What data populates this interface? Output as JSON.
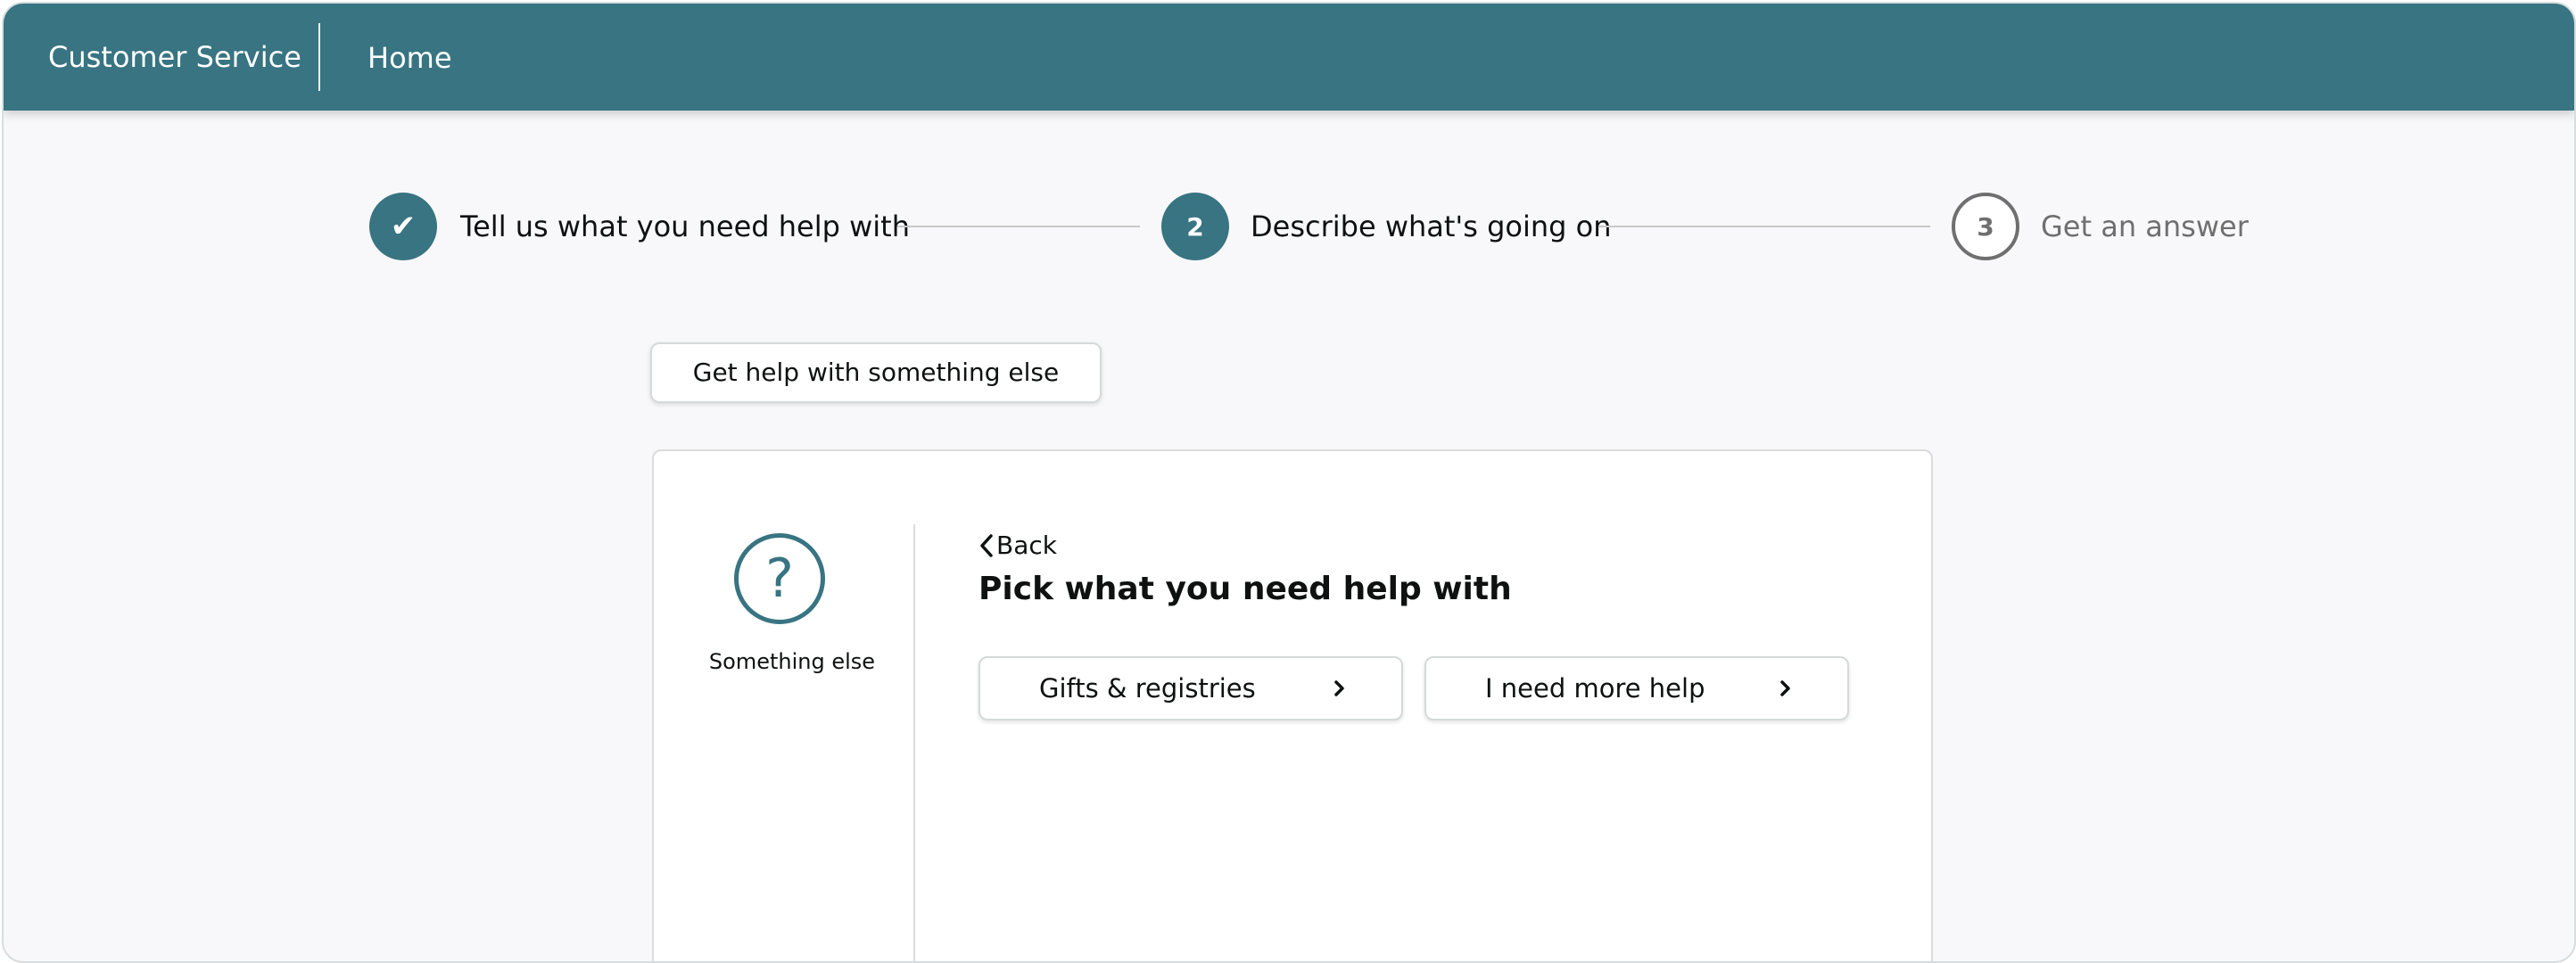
{
  "header": {
    "brand": "Customer Service",
    "home_link": "Home",
    "background_color": "#387482"
  },
  "stepper": {
    "steps": [
      {
        "marker": "✔",
        "label": "Tell us what you need help with",
        "state": "completed"
      },
      {
        "marker": "2",
        "label": "Describe what's going on",
        "state": "active"
      },
      {
        "marker": "3",
        "label": "Get an answer",
        "state": "pending"
      }
    ]
  },
  "else_button": {
    "label": "Get help with something else"
  },
  "card": {
    "topic": {
      "icon": "question-mark-icon",
      "glyph": "?",
      "label": "Something else"
    },
    "back_label": "Back",
    "title": "Pick what you need help with",
    "options": [
      {
        "label": "Gifts & registries",
        "icon": "chevron-right-icon"
      },
      {
        "label": "I need more help",
        "icon": "chevron-right-icon"
      }
    ]
  }
}
